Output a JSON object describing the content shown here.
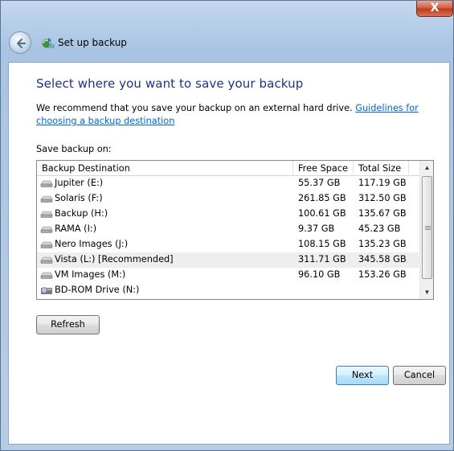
{
  "window": {
    "title": "Set up backup",
    "close_label": "X"
  },
  "page": {
    "heading": "Select where you want to save your backup",
    "recommend_text": "We recommend that you save your backup on an external hard drive. ",
    "guidelines_link": "Guidelines for choosing a backup destination",
    "save_label": "Save backup on:"
  },
  "table": {
    "columns": [
      "Backup Destination",
      "Free Space",
      "Total Size"
    ],
    "rows": [
      {
        "name": "Jupiter (E:)",
        "free": "55.37 GB",
        "total": "117.19 GB",
        "icon": "hard-drive-icon"
      },
      {
        "name": "Solaris (F:)",
        "free": "261.85 GB",
        "total": "312.50 GB",
        "icon": "hard-drive-icon"
      },
      {
        "name": "Backup (H:)",
        "free": "100.61 GB",
        "total": "135.67 GB",
        "icon": "hard-drive-icon"
      },
      {
        "name": "RAMA (I:)",
        "free": "9.37 GB",
        "total": "45.23 GB",
        "icon": "hard-drive-icon"
      },
      {
        "name": "Nero Images (J:)",
        "free": "108.15 GB",
        "total": "135.23 GB",
        "icon": "hard-drive-icon"
      },
      {
        "name": "Vista (L:) [Recommended]",
        "free": "311.71 GB",
        "total": "345.58 GB",
        "icon": "hard-drive-icon",
        "selected": true
      },
      {
        "name": "VM Images (M:)",
        "free": "96.10 GB",
        "total": "153.26 GB",
        "icon": "hard-drive-icon"
      },
      {
        "name": "BD-ROM Drive (N:)",
        "free": "",
        "total": "",
        "icon": "optical-drive-icon"
      }
    ]
  },
  "buttons": {
    "refresh": "Refresh",
    "next": "Next",
    "cancel": "Cancel"
  },
  "colors": {
    "heading": "#1e3287",
    "link": "#0066cc",
    "selected_row": "#eeeeee"
  }
}
